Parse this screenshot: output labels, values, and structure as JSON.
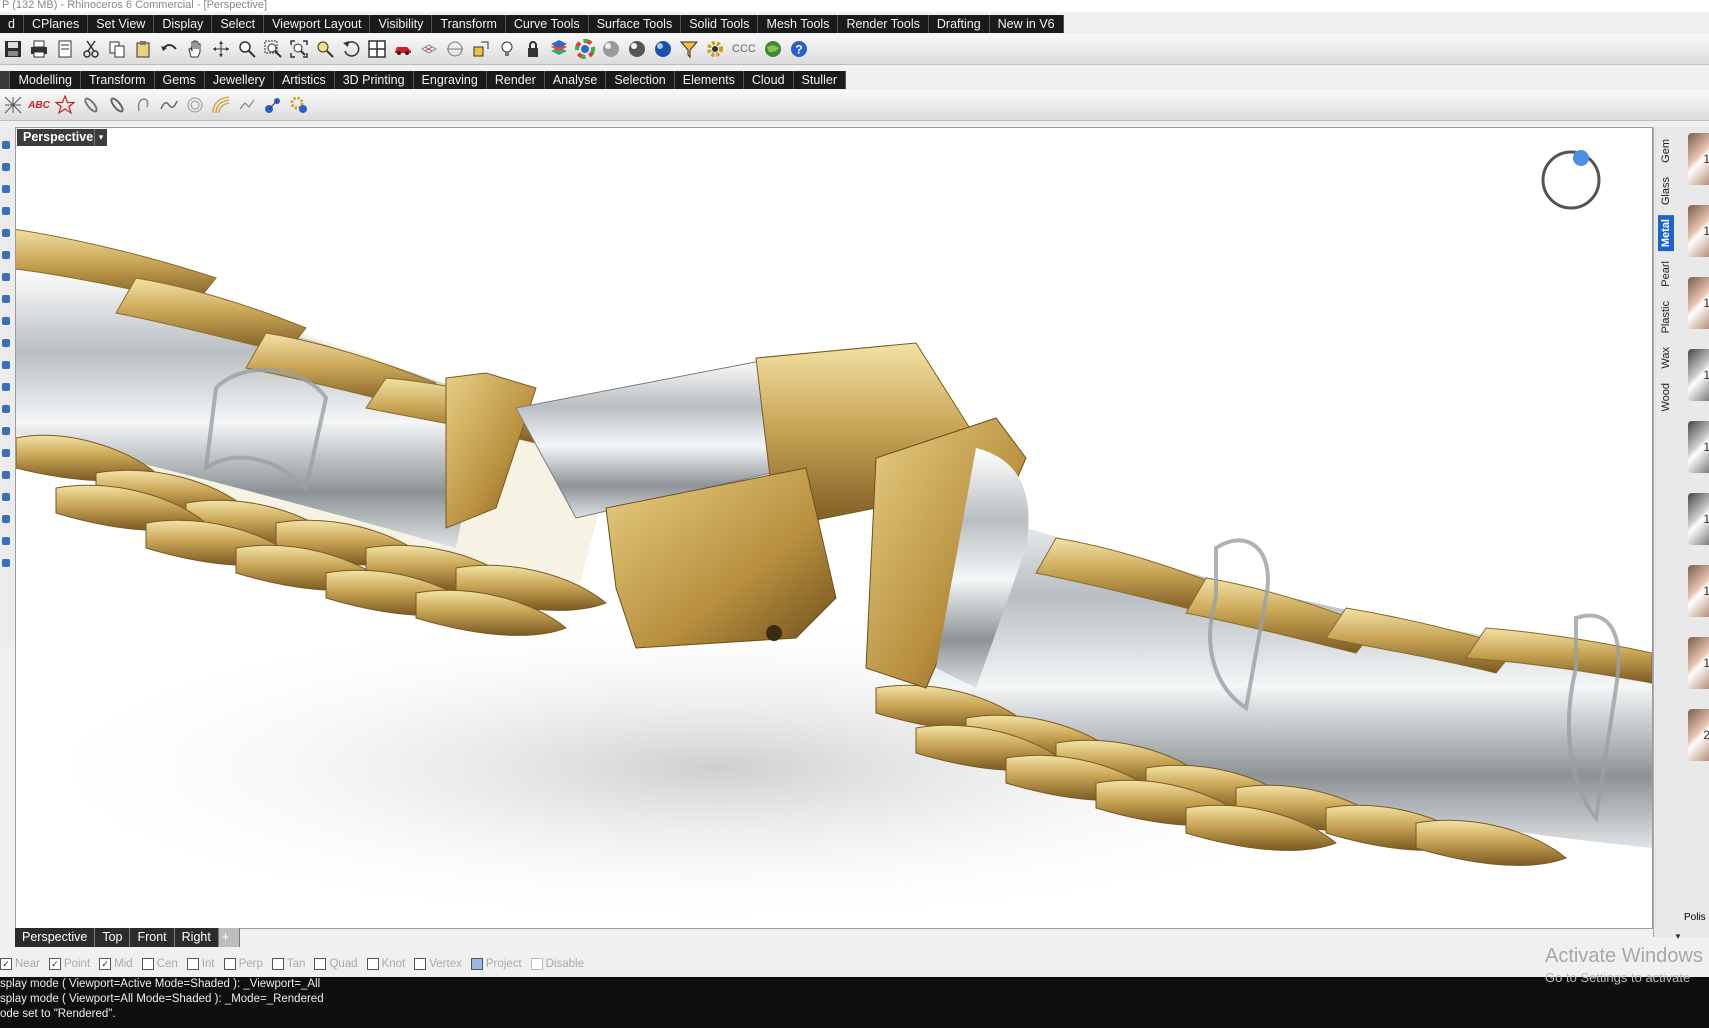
{
  "window": {
    "title": "P (132 MB) - Rhinoceros 6 Commercial - [Perspective]"
  },
  "top_tabs": [
    "d",
    "CPlanes",
    "Set View",
    "Display",
    "Select",
    "Viewport Layout",
    "Visibility",
    "Transform",
    "Curve Tools",
    "Surface Tools",
    "Solid Tools",
    "Mesh Tools",
    "Render Tools",
    "Drafting",
    "New in V6"
  ],
  "main_toolbar": {
    "icons": [
      "save-icon",
      "print-icon",
      "copy-doc-icon",
      "cut-icon",
      "copy-icon",
      "paste-icon",
      "undo-icon",
      "pan-hand-icon",
      "rotate-view-icon",
      "zoom-icon",
      "zoom-window-icon",
      "zoom-extents-icon",
      "zoom-selected-icon",
      "undo-view-icon",
      "four-viewports-icon",
      "car-icon",
      "grid-icon",
      "target-icon",
      "cplane-icon",
      "light-bulb-icon",
      "lock-icon",
      "layer-icon",
      "color-wheel-icon",
      "sphere-shaded-icon",
      "sphere-rendered-icon",
      "sphere-blue-icon",
      "filter-icon",
      "gear-icon"
    ],
    "ccc_label": "CCC",
    "help_icons": [
      "globe-icon",
      "help-icon"
    ]
  },
  "second_tabs": [
    "Modelling",
    "Transform",
    "Gems",
    "Jewellery",
    "Artistics",
    "3D Printing",
    "Engraving",
    "Render",
    "Analyse",
    "Selection",
    "Elements",
    "Cloud",
    "Stuller"
  ],
  "second_toolbar": {
    "icons": [
      "mesh-x-icon",
      "text-abc-icon",
      "star-icon",
      "chain-link-icon",
      "chain-link-2-icon",
      "bail-icon",
      "wave-curve-icon",
      "coil-icon",
      "rope-icon",
      "split-icon",
      "molecule-icon",
      "molecule-gear-icon"
    ],
    "abc_label": "ABC"
  },
  "viewport": {
    "label": "Perspective",
    "dropdown": "▾"
  },
  "right_panel": {
    "tabs": [
      "Gem",
      "Glass",
      "Metal",
      "Pearl",
      "Plastic",
      "Wax",
      "Wood"
    ],
    "active_tab": "Metal",
    "swatch_labels": [
      "1",
      "1",
      "1",
      "1",
      "1",
      "1",
      "1",
      "1",
      "2"
    ],
    "footer_label": "Polis"
  },
  "viewport_tabs": [
    "Perspective",
    "Top",
    "Front",
    "Right",
    "+"
  ],
  "osnap": [
    {
      "label": "Near",
      "checked": true
    },
    {
      "label": "Point",
      "checked": true
    },
    {
      "label": "Mid",
      "checked": true
    },
    {
      "label": "Cen",
      "checked": false
    },
    {
      "label": "Int",
      "checked": false
    },
    {
      "label": "Perp",
      "checked": false
    },
    {
      "label": "Tan",
      "checked": false
    },
    {
      "label": "Quad",
      "checked": false
    },
    {
      "label": "Knot",
      "checked": false
    },
    {
      "label": "Vertex",
      "checked": false
    },
    {
      "label": "Project",
      "checked": true
    },
    {
      "label": "Disable",
      "checked": false
    }
  ],
  "command_history": [
    "splay mode ( Viewport=Active  Mode=Shaded ): _Viewport=_All",
    "splay mode ( Viewport=All  Mode=Shaded ): _Mode=_Rendered",
    "ode set to \"Rendered\"."
  ],
  "watermark": {
    "line1": "Activate Windows",
    "line2": "Go to Settings to activate"
  },
  "colors": {
    "tab_bg": "#1b1b1b",
    "accent_blue": "#1e64c8",
    "gold": "#c9a656",
    "silver": "#cfd3d6"
  }
}
